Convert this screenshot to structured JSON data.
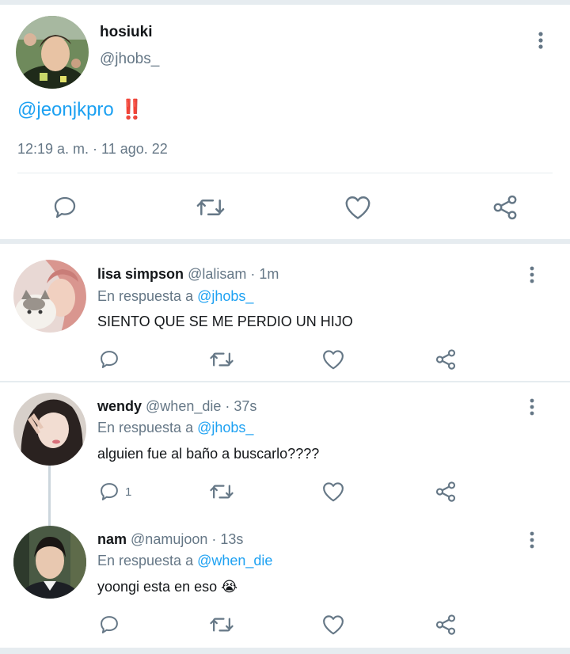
{
  "main_tweet": {
    "name": "hosiuki",
    "handle": "@jhobs_",
    "mention": "@jeonjkpro",
    "emoji": "‼️",
    "timestamp": "12:19 a. m. · 11 ago. 22",
    "actions": [
      "reply-icon",
      "retweet-icon",
      "like-icon",
      "share-icon"
    ]
  },
  "replies": [
    {
      "name": "lisa simpson",
      "handle": "@lalisam",
      "time": "· 1m",
      "in_reply_label": "En respuesta a",
      "in_reply_to": "@jhobs_",
      "text": "SIENTO QUE SE ME PERDIO UN HIJO",
      "reply_count": ""
    },
    {
      "name": "wendy",
      "handle": "@when_die",
      "time": "· 37s",
      "in_reply_label": "En respuesta a",
      "in_reply_to": "@jhobs_",
      "text": "alguien fue al baño a buscarlo????",
      "reply_count": "1"
    },
    {
      "name": "nam",
      "handle": "@namujoon",
      "time": "· 13s",
      "in_reply_label": "En respuesta a",
      "in_reply_to": "@when_die",
      "text": "yoongi esta en eso 😭",
      "reply_count": ""
    }
  ],
  "colors": {
    "accent": "#1da1f2",
    "secondary_text": "#657786",
    "icon": "#657786",
    "divider": "#e6ecf0",
    "thread_line": "#ccd6dd"
  }
}
